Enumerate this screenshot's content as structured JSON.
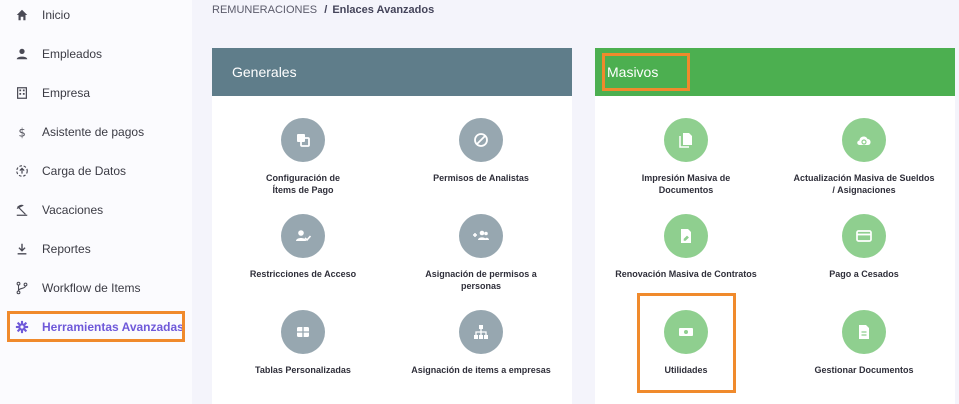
{
  "sidebar": {
    "items": [
      {
        "label": "Inicio",
        "icon": "home-icon"
      },
      {
        "label": "Empleados",
        "icon": "person-icon"
      },
      {
        "label": "Empresa",
        "icon": "building-icon"
      },
      {
        "label": "Asistente de pagos",
        "icon": "dollar-icon"
      },
      {
        "label": "Carga de Datos",
        "icon": "upload-circle-icon"
      },
      {
        "label": "Vacaciones",
        "icon": "beach-icon"
      },
      {
        "label": "Reportes",
        "icon": "download-icon"
      },
      {
        "label": "Workflow de Items",
        "icon": "branch-icon"
      },
      {
        "label": "Herramientas Avanzadas",
        "icon": "gear-icon",
        "active": true
      }
    ]
  },
  "breadcrumb": {
    "parent": "REMUNERACIONES",
    "separator": "/",
    "current": "Enlaces Avanzados"
  },
  "generales": {
    "title": "Generales",
    "tiles": [
      {
        "label1": "Configuración de",
        "label2": "Ítems de Pago",
        "icon": "copy-icon"
      },
      {
        "label1": "Permisos de Analistas",
        "label2": "",
        "icon": "block-icon"
      },
      {
        "label1": "Restricciones de Acceso",
        "label2": "",
        "icon": "user-check-icon"
      },
      {
        "label1": "Asignación de permisos a",
        "label2": "personas",
        "icon": "group-add-icon"
      },
      {
        "label1": "Tablas Personalizadas",
        "label2": "",
        "icon": "table-icon"
      },
      {
        "label1": "Asignación de items a empresas",
        "label2": "",
        "icon": "hierarchy-icon"
      }
    ]
  },
  "masivos": {
    "title": "Masivos",
    "tiles": [
      {
        "label1": "Impresión Masiva de",
        "label2": "Documentos",
        "icon": "documents-icon"
      },
      {
        "label1": "Actualización Masiva de Sueldos",
        "label2": "/ Asignaciones",
        "icon": "cloud-sync-icon"
      },
      {
        "label1": "Renovación Masiva de Contratos",
        "label2": "",
        "icon": "file-edit-icon"
      },
      {
        "label1": "Pago a Cesados",
        "label2": "",
        "icon": "card-icon"
      },
      {
        "label1": "Utilidades",
        "label2": "",
        "icon": "money-icon"
      },
      {
        "label1": "Gestionar Documentos",
        "label2": "",
        "icon": "document-icon"
      }
    ]
  },
  "colors": {
    "accent": "#6f59d9",
    "generales_header": "#5f7d8a",
    "masivos_header": "#4caf50",
    "highlight": "#f08a2c"
  }
}
